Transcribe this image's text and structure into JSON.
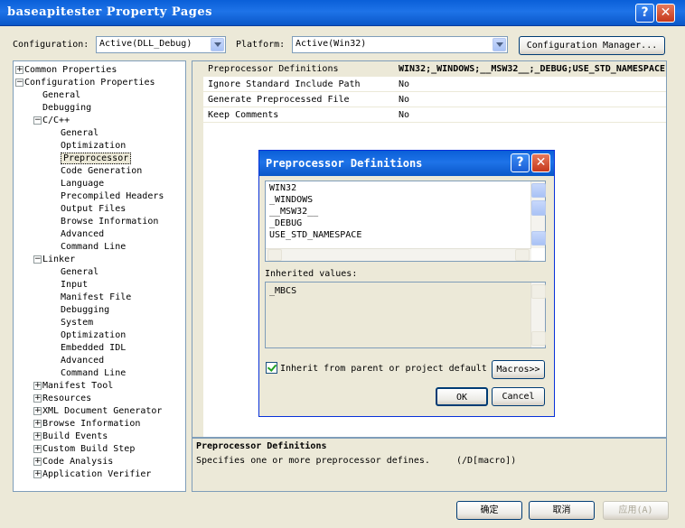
{
  "window": {
    "title": "baseapitester Property Pages",
    "help_glyph": "?",
    "close_glyph": "✕"
  },
  "toolbar": {
    "configuration_label": "Configuration:",
    "configuration_value": "Active(DLL_Debug)",
    "platform_label": "Platform:",
    "platform_value": "Active(Win32)",
    "config_manager_label": "Configuration Manager..."
  },
  "tree": {
    "items": [
      {
        "label": "Common Properties",
        "indent": 0,
        "expander": "+"
      },
      {
        "label": "Configuration Properties",
        "indent": 0,
        "expander": "−"
      },
      {
        "label": "General",
        "indent": 1
      },
      {
        "label": "Debugging",
        "indent": 1
      },
      {
        "label": "C/C++",
        "indent": 1,
        "expander": "−"
      },
      {
        "label": "General",
        "indent": 2
      },
      {
        "label": "Optimization",
        "indent": 2
      },
      {
        "label": "Preprocessor",
        "indent": 2,
        "selected": true
      },
      {
        "label": "Code Generation",
        "indent": 2
      },
      {
        "label": "Language",
        "indent": 2
      },
      {
        "label": "Precompiled Headers",
        "indent": 2
      },
      {
        "label": "Output Files",
        "indent": 2
      },
      {
        "label": "Browse Information",
        "indent": 2
      },
      {
        "label": "Advanced",
        "indent": 2
      },
      {
        "label": "Command Line",
        "indent": 2
      },
      {
        "label": "Linker",
        "indent": 1,
        "expander": "−"
      },
      {
        "label": "General",
        "indent": 2
      },
      {
        "label": "Input",
        "indent": 2
      },
      {
        "label": "Manifest File",
        "indent": 2
      },
      {
        "label": "Debugging",
        "indent": 2
      },
      {
        "label": "System",
        "indent": 2
      },
      {
        "label": "Optimization",
        "indent": 2
      },
      {
        "label": "Embedded IDL",
        "indent": 2
      },
      {
        "label": "Advanced",
        "indent": 2
      },
      {
        "label": "Command Line",
        "indent": 2
      },
      {
        "label": "Manifest Tool",
        "indent": 1,
        "expander": "+"
      },
      {
        "label": "Resources",
        "indent": 1,
        "expander": "+"
      },
      {
        "label": "XML Document Generator",
        "indent": 1,
        "expander": "+"
      },
      {
        "label": "Browse Information",
        "indent": 1,
        "expander": "+"
      },
      {
        "label": "Build Events",
        "indent": 1,
        "expander": "+"
      },
      {
        "label": "Custom Build Step",
        "indent": 1,
        "expander": "+"
      },
      {
        "label": "Code Analysis",
        "indent": 1,
        "expander": "+"
      },
      {
        "label": "Application Verifier",
        "indent": 1,
        "expander": "+"
      }
    ]
  },
  "properties": [
    {
      "name": "Preprocessor Definitions",
      "value": "WIN32;_WINDOWS;__MSW32__;_DEBUG;USE_STD_NAMESPACE",
      "bold": true
    },
    {
      "name": "Ignore Standard Include Path",
      "value": "No"
    },
    {
      "name": "Generate Preprocessed File",
      "value": "No"
    },
    {
      "name": "Keep Comments",
      "value": "No"
    }
  ],
  "description": {
    "title": "Preprocessor Definitions",
    "text": "Specifies one or more preprocessor defines.",
    "switch": "(/D[macro])"
  },
  "dialog": {
    "title": "Preprocessor Definitions",
    "lines": [
      "WIN32",
      "_WINDOWS",
      "__MSW32__",
      "_DEBUG",
      "USE_STD_NAMESPACE"
    ],
    "inherited_label": "Inherited values:",
    "inherited_lines": [
      "_MBCS"
    ],
    "inherit_checkbox_label": "Inherit from parent or project default",
    "macros_label": "Macros>>",
    "ok_label": "OK",
    "cancel_label": "Cancel"
  },
  "footer": {
    "ok_label": "确定",
    "cancel_label": "取消",
    "apply_label": "应用(A)"
  }
}
